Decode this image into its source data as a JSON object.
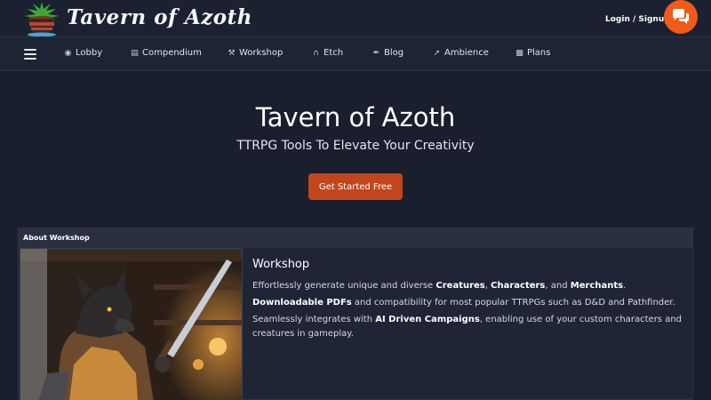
{
  "brand": {
    "name": "Tavern of Azoth",
    "logo_icon": "cauldron-icon"
  },
  "header": {
    "login_label": "Login / Signup",
    "chat_icon": "chat-bubbles-icon",
    "accent": "#f05a1a"
  },
  "nav": {
    "menu_icon": "hamburger-icon",
    "items": [
      {
        "label": "Lobby",
        "icon": "lobby-icon"
      },
      {
        "label": "Compendium",
        "icon": "books-icon"
      },
      {
        "label": "Workshop",
        "icon": "hammer-icon"
      },
      {
        "label": "Etch",
        "icon": "etch-icon"
      },
      {
        "label": "Blog",
        "icon": "feather-icon"
      },
      {
        "label": "Ambience",
        "icon": "wand-icon"
      },
      {
        "label": "Plans",
        "icon": "coins-icon"
      }
    ]
  },
  "hero": {
    "title": "Tavern of Azoth",
    "subtitle": "TTRPG Tools To Elevate Your Creativity",
    "cta_label": "Get Started Free",
    "cta_color": "#c2461c"
  },
  "about": {
    "header": "About Workshop",
    "heading": "Workshop",
    "image_label": "werewolf-warrior-illustration",
    "p1": {
      "t1": "Effortlessly generate unique and diverse ",
      "b1": "Creatures",
      "t2": ", ",
      "b2": "Characters",
      "t3": ", and ",
      "b3": "Merchants",
      "t4": "."
    },
    "p2": {
      "b1": "Downloadable PDFs",
      "t1": " and compatibility for most popular TTRPGs such as D&D and Pathfinder."
    },
    "p3": {
      "t1": "Seamlessly integrates with ",
      "b1": "AI Driven Campaigns",
      "t2": ", enabling use of your custom characters and creatures in gameplay."
    }
  }
}
